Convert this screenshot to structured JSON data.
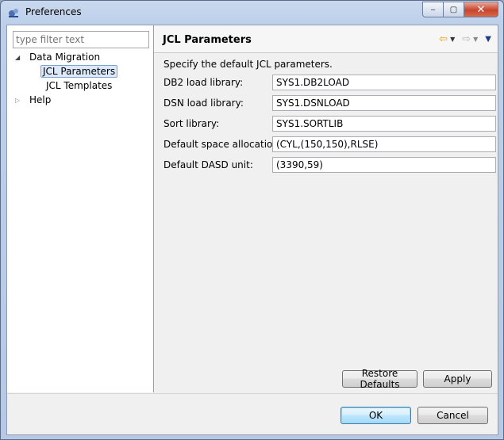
{
  "window": {
    "title": "Preferences",
    "close_glyph": "✕",
    "min_glyph": "‒",
    "max_glyph": "▢"
  },
  "filter": {
    "placeholder": "type filter text"
  },
  "tree": {
    "items": [
      {
        "label": "Data Migration",
        "expanded": true
      },
      {
        "label": "JCL Parameters",
        "selected": true
      },
      {
        "label": "JCL Templates"
      },
      {
        "label": "Help",
        "expanded": false
      }
    ]
  },
  "page": {
    "title": "JCL Parameters",
    "description": "Specify the default JCL parameters.",
    "fields": [
      {
        "label": "DB2 load library:",
        "value": "SYS1.DB2LOAD"
      },
      {
        "label": "DSN load library:",
        "value": "SYS1.DSNLOAD"
      },
      {
        "label": "Sort library:",
        "value": "SYS1.SORTLIB"
      },
      {
        "label": "Default space allocation:",
        "value": "(CYL,(150,150),RLSE)"
      },
      {
        "label": "Default DASD unit:",
        "value": "(3390,59)"
      }
    ],
    "restore_defaults_label": "Restore Defaults",
    "apply_label": "Apply"
  },
  "dialog": {
    "ok_label": "OK",
    "cancel_label": "Cancel"
  },
  "colors": {
    "back_arrow": "#e0a020",
    "forward_arrow": "#b0b0b0",
    "menu_arrow": "#1f3c88"
  }
}
